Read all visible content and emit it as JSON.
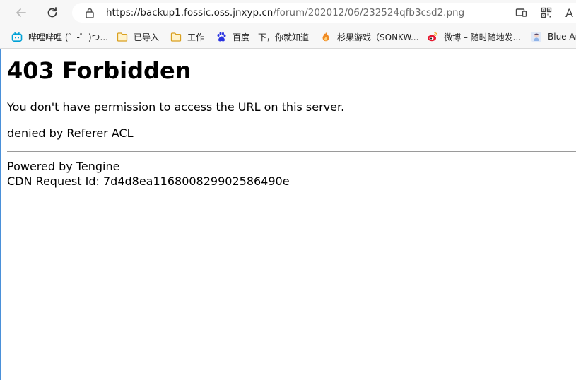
{
  "browser": {
    "back_icon": "arrow-left-icon",
    "reload_icon": "reload-icon",
    "lock_icon": "lock-icon",
    "url_host": "https://backup1.fossic.oss.jnxyp.cn",
    "url_path": "/forum/202012/06/232524qfb3csd2.png",
    "cast_icon": "screen-cast-icon",
    "qr_icon": "qr-code-icon",
    "read_aloud_label": "A",
    "read_aloud_icon": "read-aloud-icon"
  },
  "bookmarks": [
    {
      "label": "哔哩哔哩 (゜-゜)つ...",
      "icon": "bilibili-icon",
      "color": "#00a1d6"
    },
    {
      "label": "已导入",
      "icon": "folder-icon",
      "color": "#e8b43a"
    },
    {
      "label": "工作",
      "icon": "folder-icon",
      "color": "#e8b43a"
    },
    {
      "label": "百度一下，你就知道",
      "icon": "baidu-paw-icon",
      "color": "#2932e1"
    },
    {
      "label": "杉果游戏（SONKW...",
      "icon": "sonkwo-flame-icon",
      "color": "#f08a24"
    },
    {
      "label": "微博 – 随时随地发...",
      "icon": "weibo-icon",
      "color": "#e6162d"
    },
    {
      "label": "Blue Ar",
      "icon": "blue-archive-icon",
      "color": "#8fb3e8"
    }
  ],
  "page": {
    "heading": "403 Forbidden",
    "message": "You don't have permission to access the URL on this server.",
    "reason": "denied by Referer ACL",
    "powered_by": "Powered by Tengine",
    "request_id": "CDN Request Id: 7d4d8ea116800829902586490e"
  }
}
